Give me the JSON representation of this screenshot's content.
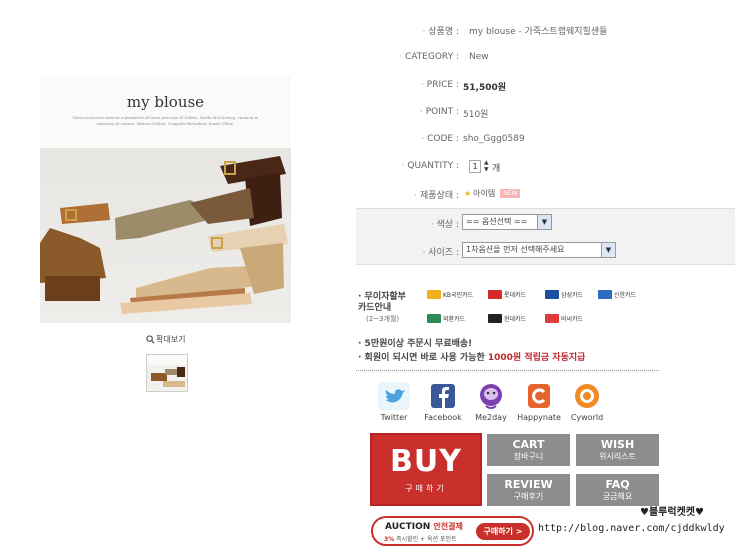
{
  "product": {
    "name_label": "상품명 :",
    "name": "my blouse - 가죽스트랩웨지힐샌들",
    "category_label": "CATEGORY :",
    "category": "New",
    "price_label": "PRICE :",
    "price": "51,500원",
    "point_label": "POINT :",
    "point": "510원",
    "code_label": "CODE :",
    "code": "sho_Ggg0589",
    "quantity_label": "QUANTITY :",
    "quantity": "1",
    "quantity_unit": "개",
    "status_label": "제품상태 :",
    "status_value": "아이템",
    "new_badge": "NEW"
  },
  "image": {
    "brand": "my blouse",
    "blurb": "Ginocca teneva reterve a pantaloni di linea principe di Galles, Stella McCartney; camicia in seasonio al cotone, Mauro Grifoni; Coppello Borsalino; boots Chloé.",
    "zoom_label": "확대보기"
  },
  "options": {
    "color_label": "색상 :",
    "color_value": "== 옵션선택 ==",
    "size_label": "사이즈 :",
    "size_value": "1차옵션을 먼저 선택해주세요"
  },
  "payment": {
    "heading_line1": "· 무이자할부",
    "heading_line2": "  카드안내",
    "heading_sub": "(2~3개월)",
    "cards": [
      "KB국민카드",
      "롯데카드",
      "삼성카드",
      "신한카드",
      "외환카드",
      "현대카드",
      "비씨카드"
    ],
    "card_colors": [
      "#f2b01e",
      "#d62a2a",
      "#1b4fa0",
      "#2d6cc0",
      "#2e8b57",
      "#222222",
      "#e03a3a"
    ]
  },
  "notes": {
    "shipping": "· 5만원이상 주문시 무료배송!",
    "member_prefix": "· 회원이 되시면 바로 사용 가능한 ",
    "member_red": "1000원 적립금 자동지급"
  },
  "social": [
    {
      "label": "Twitter",
      "icon": "twitter-icon",
      "color": "#4aa3df"
    },
    {
      "label": "Facebook",
      "icon": "facebook-icon",
      "color": "#3b5998"
    },
    {
      "label": "Me2day",
      "icon": "me2day-icon",
      "color": "#7b3fb0"
    },
    {
      "label": "Happynate",
      "icon": "happynate-icon",
      "color": "#e8632b"
    },
    {
      "label": "Cyworld",
      "icon": "cyworld-icon",
      "color": "#f08a24"
    }
  ],
  "buttons": {
    "buy": "BUY",
    "buy_sub": "구매하기",
    "cart": "CART",
    "cart_sub": "장바구니",
    "wish": "WISH",
    "wish_sub": "위시리스트",
    "review": "REVIEW",
    "review_sub": "구매후기",
    "faq": "FAQ",
    "faq_sub": "궁금해요"
  },
  "auction": {
    "title": "AUCTION",
    "title_red": "안전결제",
    "sub_red": "3%",
    "sub": " 즉시할인 + 옥션 포인트",
    "button": "구매하기 >"
  },
  "footer": {
    "url": "http://blog.naver.com/cjddkwldy",
    "watermark": "♥블루럭켓켓♥"
  }
}
